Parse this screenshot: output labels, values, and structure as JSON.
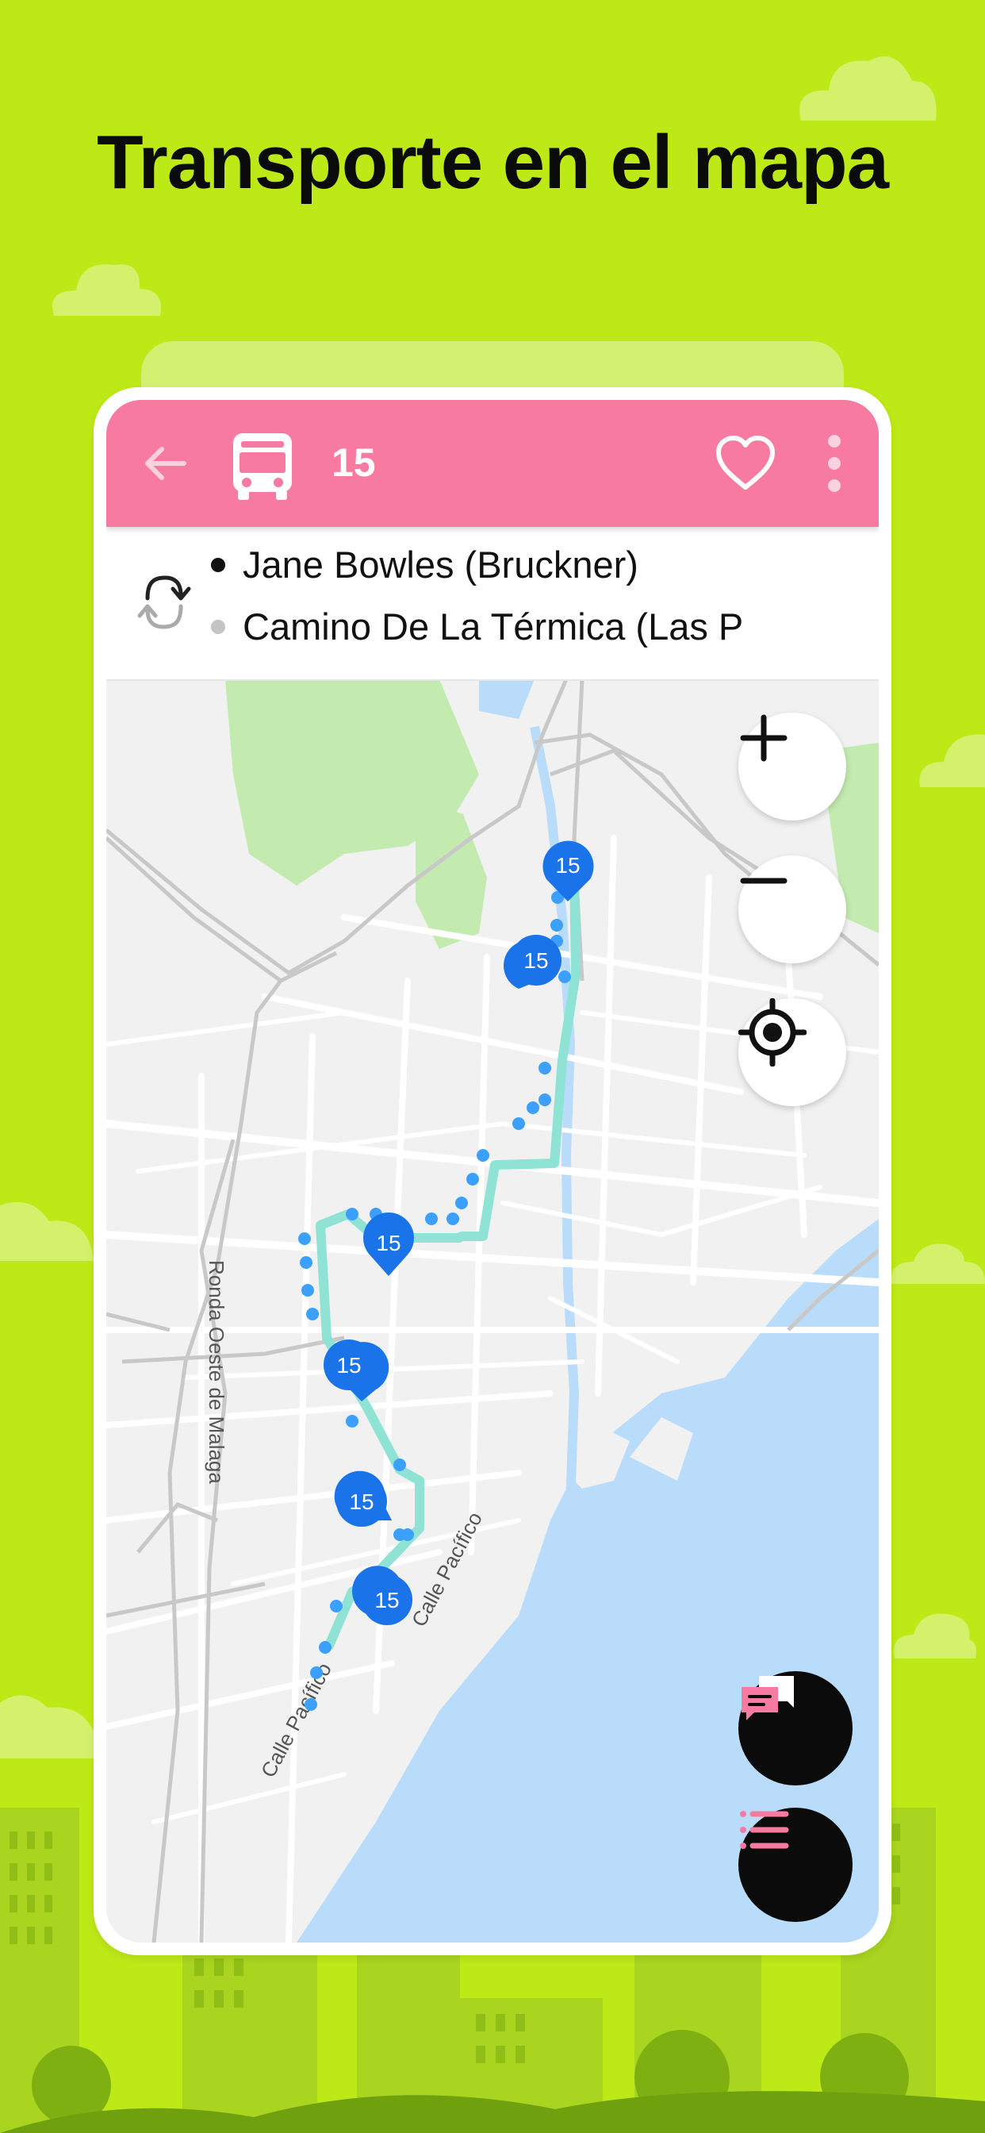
{
  "headline": "Transporte en el mapa",
  "topbar": {
    "route_number": "15",
    "back_icon": "arrow-left-icon",
    "bus_icon": "bus-icon",
    "favorite_icon": "heart-outline-icon",
    "more_icon": "more-vertical-icon",
    "color": "#f77aa0"
  },
  "stops": {
    "swap_icon": "swap-direction-icon",
    "origin": "Jane Bowles (Bruckner)",
    "destination": "Camino De La Térmica (Las P"
  },
  "map": {
    "streets": [
      "Ronda Oeste de Malaga",
      "Calle Pacífico",
      "Calle Pacífico"
    ],
    "bus_markers": [
      "15",
      "15",
      "15",
      "15",
      "15",
      "15"
    ],
    "route_color": "#8fe3d4",
    "marker_color": "#1a73e8",
    "water_color": "#b9dcfb",
    "park_color": "#c3ebb0"
  },
  "controls": {
    "zoom_in": "plus-icon",
    "zoom_out": "minus-icon",
    "locate": "my-location-icon",
    "chat": "chat-icon",
    "list": "list-icon"
  }
}
